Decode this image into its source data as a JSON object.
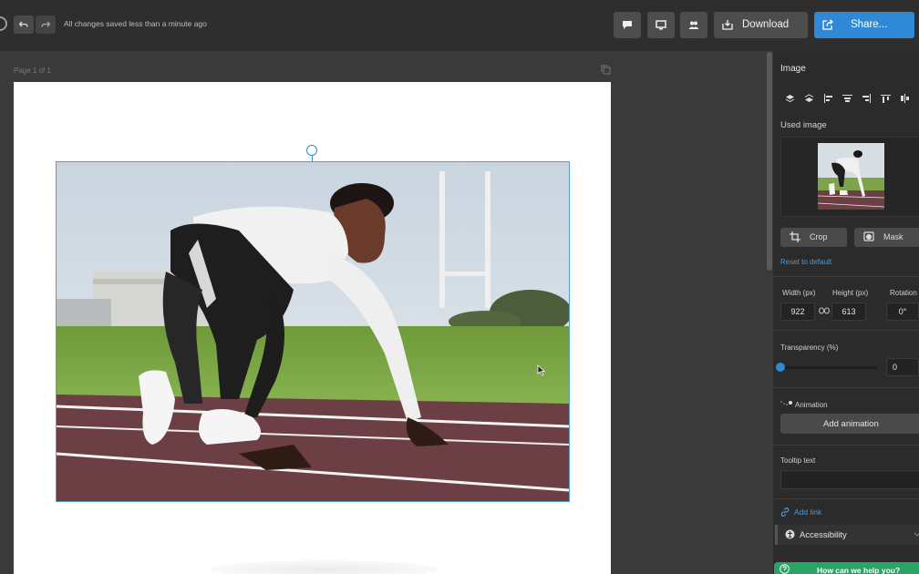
{
  "topbar": {
    "saved_status": "All changes saved less than a minute ago",
    "download_label": "Download",
    "share_label": "Share..."
  },
  "canvas": {
    "page_label": "Page 1 of 1"
  },
  "panel": {
    "title": "Image",
    "used_image_label": "Used image",
    "crop_label": "Crop",
    "mask_label": "Mask",
    "reset_label": "Reset to default",
    "width_label": "Width (px)",
    "height_label": "Height (px)",
    "rotation_label": "Rotation",
    "width_value": "922",
    "height_value": "613",
    "rotation_value": "0°",
    "transparency_label": "Transparency (%)",
    "transparency_value": "0",
    "animation_label": "Animation",
    "add_animation_label": "Add animation",
    "tooltip_label": "Tooltip text",
    "add_link_label": "Add link",
    "accessibility_label": "Accessibility"
  },
  "help": {
    "label": "How can we help you?"
  },
  "colors": {
    "accent": "#2f89d6",
    "help_green": "#2aa366"
  }
}
